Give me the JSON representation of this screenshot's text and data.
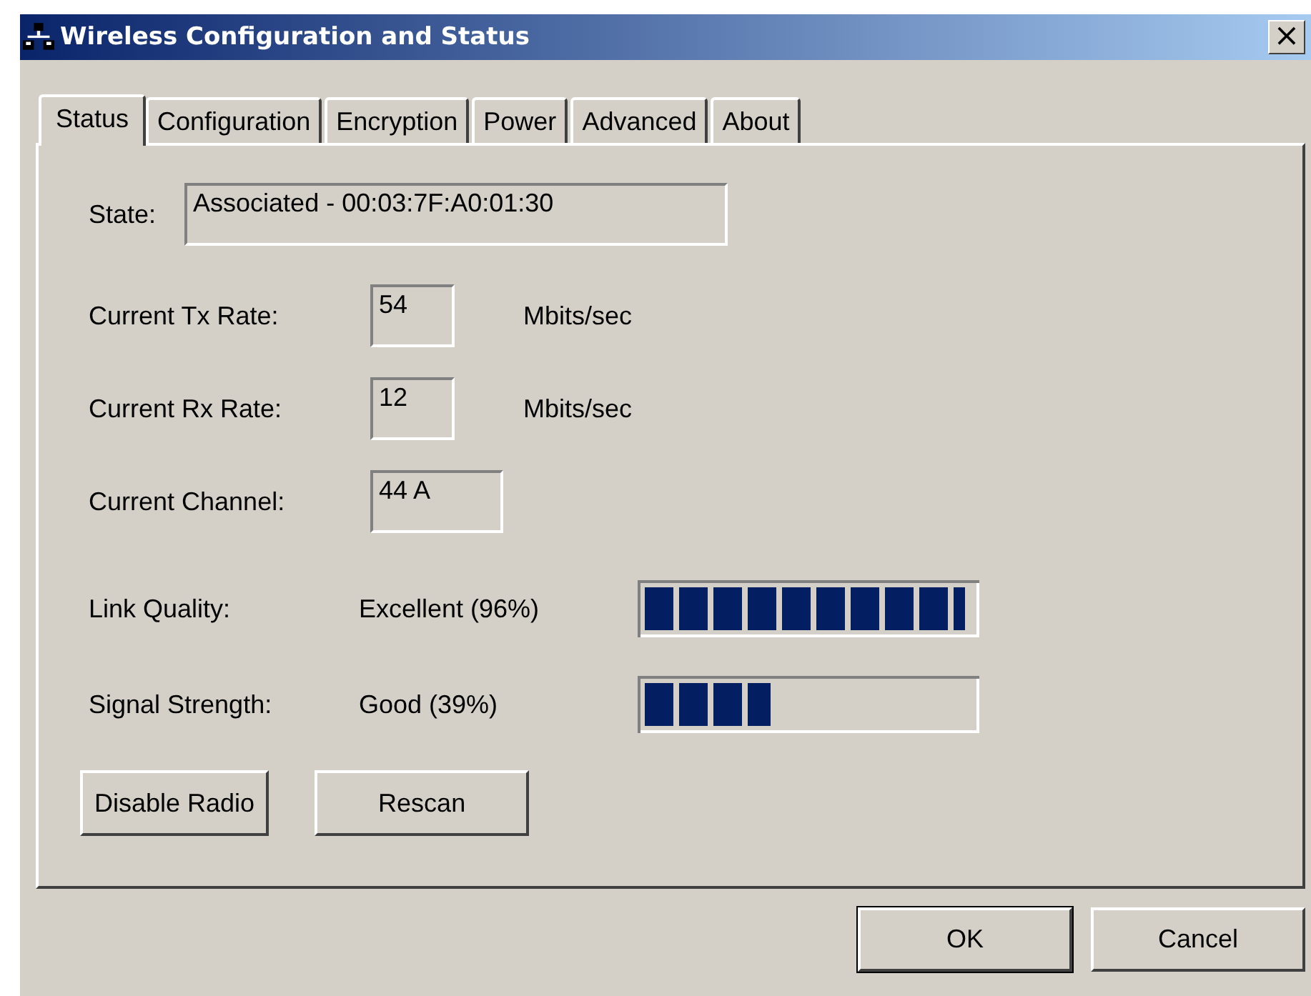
{
  "window": {
    "title": "Wireless Configuration and Status",
    "close": "×"
  },
  "tabs": [
    {
      "label": "Status",
      "selected": true
    },
    {
      "label": "Configuration",
      "selected": false
    },
    {
      "label": "Encryption",
      "selected": false
    },
    {
      "label": "Power",
      "selected": false
    },
    {
      "label": "Advanced",
      "selected": false
    },
    {
      "label": "About",
      "selected": false
    }
  ],
  "state": {
    "label": "State:",
    "value": "Associated - 00:03:7F:A0:01:30"
  },
  "rates": [
    {
      "label": "Current Tx Rate:",
      "value": "54",
      "unit": "Mbits/sec"
    },
    {
      "label": "Current Rx Rate:",
      "value": "12",
      "unit": "Mbits/sec"
    },
    {
      "label": "Current Channel:",
      "value": "44 A"
    }
  ],
  "meters": [
    {
      "label": "Link Quality:",
      "reading": "Excellent (96%)",
      "level": 0.96
    },
    {
      "label": "Signal Strength:",
      "reading": "Good (39%)",
      "level": 0.39
    }
  ],
  "panel_buttons": [
    "Disable Radio",
    "Rescan"
  ],
  "dialog_buttons": [
    {
      "label": "OK",
      "default": true
    },
    {
      "label": "Cancel",
      "default": false
    }
  ]
}
